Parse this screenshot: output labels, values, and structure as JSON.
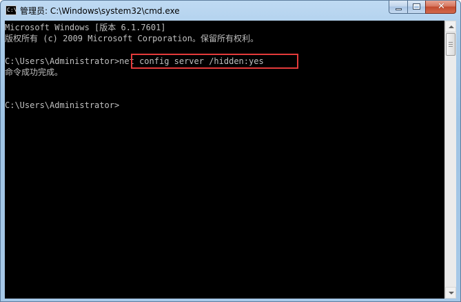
{
  "window": {
    "title": "管理员: C:\\Windows\\system32\\cmd.exe",
    "icon_text": "C:\\",
    "close_glyph": "✕"
  },
  "console": {
    "lines": [
      "Microsoft Windows [版本 6.1.7601]",
      "版权所有 (c) 2009 Microsoft Corporation。保留所有权利。",
      "",
      "C:\\Users\\Administrator>net config server /hidden:yes",
      "命令成功完成。",
      "",
      "",
      "C:\\Users\\Administrator>"
    ]
  },
  "colors": {
    "console_background": "#000000",
    "console_text": "#c0c0c0",
    "highlight_border": "#e53b3b",
    "close_button": "#c14a2e"
  },
  "icons": {
    "app": "cmd-icon",
    "minimize": "minimize-icon",
    "maximize": "maximize-icon",
    "close": "close-icon",
    "scroll_up": "arrow-up-icon",
    "scroll_down": "arrow-down-icon"
  }
}
